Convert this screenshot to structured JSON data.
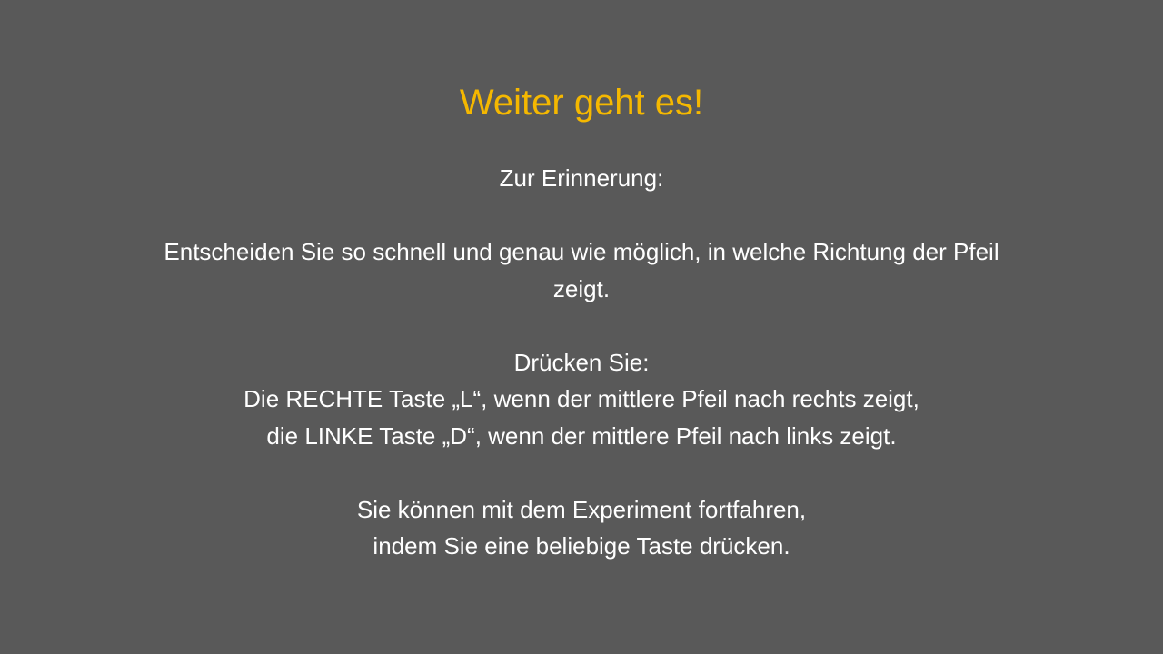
{
  "slide": {
    "background_color": "#595959",
    "title": "Weiter geht es!",
    "title_color": "#f5b800",
    "text_color": "#ffffff",
    "reminder_heading": "Zur Erinnerung:",
    "instruction_line_1": "Entscheiden Sie so schnell und genau wie möglich, in welche Richtung der Pfeil",
    "instruction_line_2": "zeigt.",
    "press_heading": "Drücken Sie:",
    "right_key_line": "Die RECHTE Taste „L“, wenn der mittlere Pfeil nach rechts zeigt,",
    "left_key_line": "die LINKE Taste „D“, wenn der mittlere Pfeil nach links zeigt.",
    "continue_line_1": "Sie können mit dem Experiment fortfahren,",
    "continue_line_2": "indem Sie eine beliebige Taste drücken."
  }
}
